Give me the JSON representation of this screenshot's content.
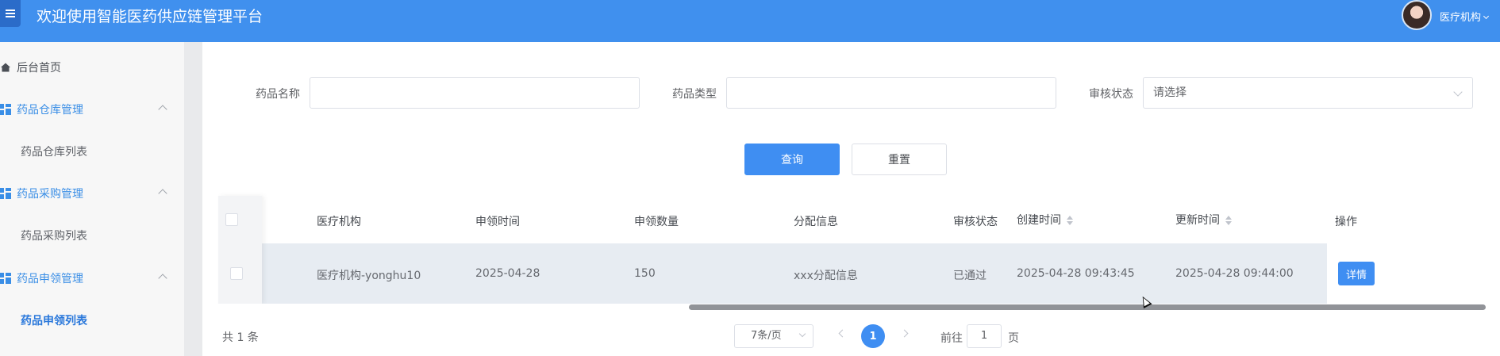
{
  "header": {
    "title": "欢迎使用智能医药供应链管理平台",
    "user": "医疗机构"
  },
  "sidebar": {
    "home": "后台首页",
    "groups": [
      {
        "label": "药品仓库管理",
        "items": [
          "药品仓库列表"
        ]
      },
      {
        "label": "药品采购管理",
        "items": [
          "药品采购列表"
        ]
      },
      {
        "label": "药品申领管理",
        "items": [
          "药品申领列表"
        ]
      }
    ],
    "active": "药品申领列表"
  },
  "search": {
    "drug_name_label": "药品名称",
    "drug_name_value": "",
    "drug_type_label": "药品类型",
    "drug_type_value": "",
    "status_label": "审核状态",
    "status_placeholder": "请选择",
    "query_button": "查询",
    "reset_button": "重置"
  },
  "table": {
    "columns": [
      "医疗机构",
      "申领时间",
      "申领数量",
      "分配信息",
      "审核状态",
      "创建时间",
      "更新时间",
      "操作"
    ],
    "rows": [
      {
        "institution": "医疗机构-yonghu10",
        "apply_time": "2025-04-28",
        "quantity": "150",
        "allocation": "xxx分配信息",
        "status": "已通过",
        "created": "2025-04-28 09:43:45",
        "updated": "2025-04-28 09:44:00",
        "action": "详情"
      }
    ]
  },
  "pagination": {
    "total": "共 1 条",
    "page_size": "7条/页",
    "current_page": "1",
    "goto_prefix": "前往",
    "goto_value": "1",
    "goto_suffix": "页"
  },
  "colors": {
    "primary": "#3f8ef2",
    "header": "#4090ee"
  }
}
